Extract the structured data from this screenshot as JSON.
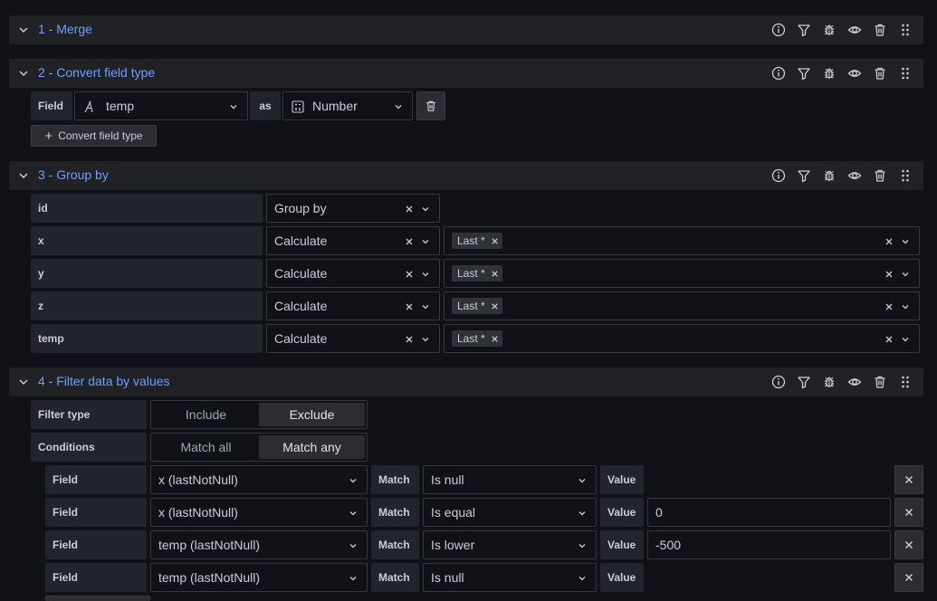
{
  "sections": [
    {
      "title": "1 - Merge"
    },
    {
      "title": "2 - Convert field type"
    },
    {
      "title": "3 - Group by"
    },
    {
      "title": "4 - Filter data by values"
    }
  ],
  "convert": {
    "field_label": "Field",
    "field_value": "temp",
    "as_label": "as",
    "type_value": "Number",
    "add_button": "Convert field type"
  },
  "groupby": {
    "rows": [
      {
        "field": "id",
        "mode": "Group by",
        "calcs": []
      },
      {
        "field": "x",
        "mode": "Calculate",
        "calcs": [
          "Last *"
        ]
      },
      {
        "field": "y",
        "mode": "Calculate",
        "calcs": [
          "Last *"
        ]
      },
      {
        "field": "z",
        "mode": "Calculate",
        "calcs": [
          "Last *"
        ]
      },
      {
        "field": "temp",
        "mode": "Calculate",
        "calcs": [
          "Last *"
        ]
      }
    ]
  },
  "filter": {
    "filter_type_label": "Filter type",
    "filter_type_options": [
      "Include",
      "Exclude"
    ],
    "filter_type_selected": "Exclude",
    "conditions_label": "Conditions",
    "conditions_options": [
      "Match all",
      "Match any"
    ],
    "conditions_selected": "Match any",
    "rows": [
      {
        "field_label": "Field",
        "field": "x (lastNotNull)",
        "match_label": "Match",
        "match": "Is null",
        "value_label": "Value",
        "value": null
      },
      {
        "field_label": "Field",
        "field": "x (lastNotNull)",
        "match_label": "Match",
        "match": "Is equal",
        "value_label": "Value",
        "value": "0"
      },
      {
        "field_label": "Field",
        "field": "temp (lastNotNull)",
        "match_label": "Match",
        "match": "Is lower",
        "value_label": "Value",
        "value": "-500"
      },
      {
        "field_label": "Field",
        "field": "temp (lastNotNull)",
        "match_label": "Match",
        "match": "Is null",
        "value_label": "Value",
        "value": null
      }
    ]
  },
  "icons": {
    "header": [
      "info-icon",
      "filter-icon",
      "bug-icon",
      "eye-icon",
      "trash-icon",
      "drag-handle-icon"
    ]
  },
  "colors": {
    "accent": "#6e9fff",
    "background": "#111217",
    "header": "#202226",
    "label": "#22252b",
    "text": "#ccccdc"
  }
}
